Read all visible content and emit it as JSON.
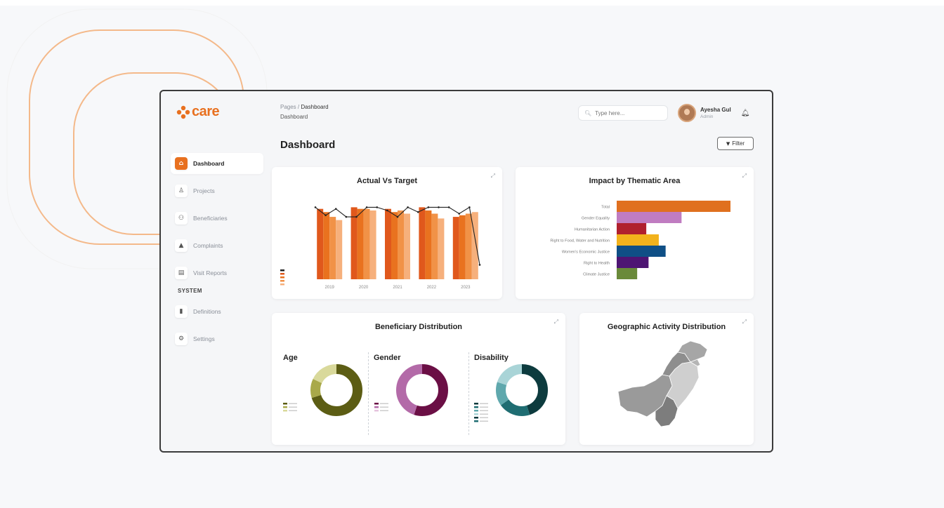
{
  "brand": {
    "name": "care",
    "logo_color": "#e8701f"
  },
  "breadcrumb": {
    "root": "Pages",
    "separator": "/",
    "current": "Dashboard",
    "sub": "Dashboard"
  },
  "page_title": "Dashboard",
  "search": {
    "placeholder": "Type here...",
    "icon": "search-icon"
  },
  "user": {
    "name": "Ayesha Gul",
    "role": "Admin"
  },
  "filter": {
    "label": "Filter",
    "icon": "filter-icon"
  },
  "sidebar": {
    "items": [
      {
        "label": "Dashboard",
        "icon": "home-icon",
        "glyph": "⌂",
        "active": true
      },
      {
        "label": "Projects",
        "icon": "projects-icon",
        "glyph": "♙",
        "active": false
      },
      {
        "label": "Beneficiaries",
        "icon": "users-icon",
        "glyph": "⚇",
        "active": false
      },
      {
        "label": "Complaints",
        "icon": "alert-icon",
        "glyph": "▲",
        "active": false
      },
      {
        "label": "Visit Reports",
        "icon": "report-icon",
        "glyph": "▤",
        "active": false
      }
    ],
    "section_label": "SYSTEM",
    "system_items": [
      {
        "label": "Definitions",
        "icon": "definitions-icon",
        "glyph": "▮"
      },
      {
        "label": "Settings",
        "icon": "settings-icon",
        "glyph": "⚙"
      }
    ]
  },
  "cards": {
    "actual_vs_target": {
      "title": "Actual Vs Target"
    },
    "thematic": {
      "title": "Impact by Thematic Area"
    },
    "beneficiary": {
      "title": "Beneficiary Distribution",
      "age": "Age",
      "gender": "Gender",
      "disability": "Disability"
    },
    "geographic": {
      "title": "Geographic Activity Distribution"
    }
  },
  "colors": {
    "accent": "#e8701f",
    "bar_palette": [
      "#e0581c",
      "#e9721f",
      "#f19247",
      "#f6b07c"
    ],
    "thematic": [
      "#e0701f",
      "#c07cc1",
      "#b0202e",
      "#f2b21c",
      "#0f4f86",
      "#4e1573",
      "#6a8a3a"
    ],
    "age": [
      "#5c5d14",
      "#a9a94a",
      "#d9d99b"
    ],
    "gender": [
      "#6b0f45",
      "#b36aa8",
      "#e6c4de"
    ],
    "disability": [
      "#0d3b3e",
      "#1f6d72",
      "#5fa8ad",
      "#a9d4d7"
    ]
  },
  "chart_data": [
    {
      "type": "bar",
      "title": "Actual Vs Target",
      "categories": [
        "2019",
        "2020",
        "2021",
        "2022",
        "2023"
      ],
      "series": [
        {
          "values": [
            88,
            90,
            88,
            90,
            78
          ]
        },
        {
          "values": [
            84,
            88,
            84,
            86,
            80
          ]
        },
        {
          "values": [
            78,
            88,
            86,
            82,
            82
          ]
        },
        {
          "values": [
            74,
            86,
            82,
            76,
            84
          ]
        }
      ],
      "line": [
        90,
        80,
        88,
        78,
        78,
        90,
        90,
        86,
        78,
        90,
        84,
        90,
        90,
        90,
        82,
        90,
        18
      ],
      "ylim": [
        0,
        100
      ]
    },
    {
      "type": "bar",
      "orientation": "horizontal",
      "title": "Impact by Thematic Area",
      "categories": [
        "Total",
        "Gender Equality",
        "Humanitarian Action",
        "Right to Food, Water and Nutrition",
        "Women's Economic Justice",
        "Right to Health",
        "Climate Justice"
      ],
      "values": [
        100,
        57,
        26,
        37,
        43,
        28,
        18
      ],
      "xlim": [
        0,
        100
      ]
    },
    {
      "type": "pie",
      "title": "Age",
      "values": [
        70,
        12,
        18
      ]
    },
    {
      "type": "pie",
      "title": "Gender",
      "values": [
        55,
        45
      ]
    },
    {
      "type": "pie",
      "title": "Disability",
      "values": [
        45,
        20,
        15,
        20
      ]
    }
  ],
  "map": {
    "title": "Geographic Activity Distribution"
  }
}
